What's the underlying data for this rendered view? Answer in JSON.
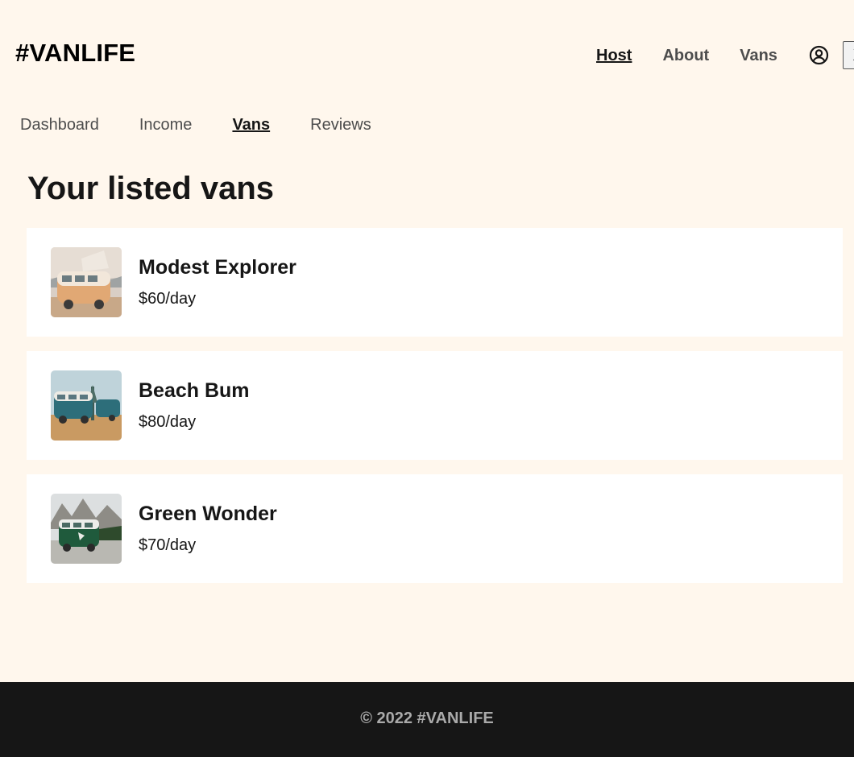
{
  "header": {
    "logo": "#VANLIFE",
    "nav": [
      {
        "label": "Host",
        "active": true
      },
      {
        "label": "About",
        "active": false
      },
      {
        "label": "Vans",
        "active": false
      }
    ],
    "user_icon": "user-circle-icon",
    "close_label": "X"
  },
  "subnav": [
    {
      "label": "Dashboard",
      "active": false
    },
    {
      "label": "Income",
      "active": false
    },
    {
      "label": "Vans",
      "active": true
    },
    {
      "label": "Reviews",
      "active": false
    }
  ],
  "main": {
    "title": "Your listed vans",
    "vans": [
      {
        "name": "Modest Explorer",
        "price": "$60/day",
        "image_icon": "orange-campervan-photo"
      },
      {
        "name": "Beach Bum",
        "price": "$80/day",
        "image_icon": "teal-van-beach-photo"
      },
      {
        "name": "Green Wonder",
        "price": "$70/day",
        "image_icon": "green-van-mountains-photo"
      }
    ]
  },
  "footer": {
    "text": "© 2022 #VANLIFE"
  },
  "colors": {
    "background": "#FFF7ED",
    "card": "#FFFFFF",
    "text": "#161616",
    "muted": "#4D4D4D",
    "footer_bg": "#161616",
    "footer_text": "#AAAAAA"
  }
}
